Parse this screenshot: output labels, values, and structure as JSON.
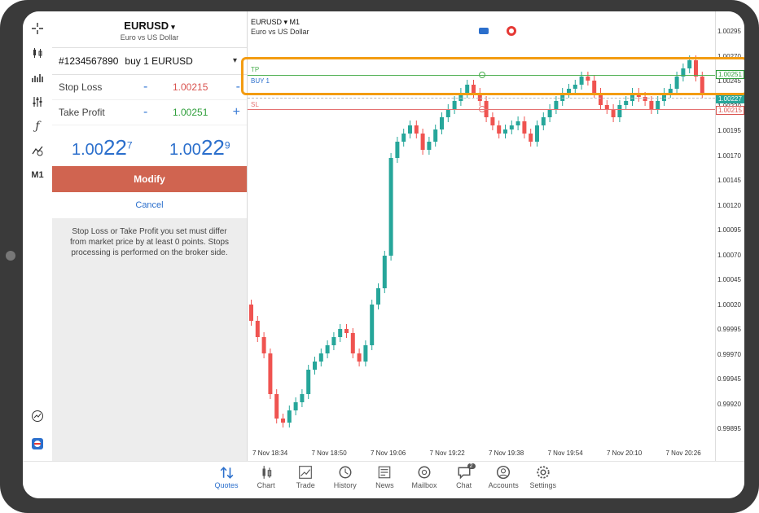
{
  "symbol": {
    "name": "EURUSD",
    "description": "Euro vs US Dollar"
  },
  "ticket": {
    "id": "#1234567890",
    "order": "buy 1 EURUSD"
  },
  "stop_loss": {
    "label": "Stop Loss",
    "value": "1.00215"
  },
  "take_profit": {
    "label": "Take Profit",
    "value": "1.00251"
  },
  "bid": {
    "main": "1.00",
    "big": "22",
    "small": "7"
  },
  "ask": {
    "main": "1.00",
    "big": "22",
    "small": "9"
  },
  "buttons": {
    "modify": "Modify",
    "cancel": "Cancel"
  },
  "note": "Stop Loss or Take Profit you set must differ from market price by at least 0 points. Stops processing is performed on the broker side.",
  "toolbar": {
    "timeframe": "M1"
  },
  "chart": {
    "title": "EURUSD ▾ M1",
    "subtitle": "Euro vs US Dollar",
    "yticks": [
      "1.00295",
      "1.00270",
      "1.00245",
      "1.00220",
      "1.00195",
      "1.00170",
      "1.00145",
      "1.00120",
      "1.00095",
      "1.00070",
      "1.00045",
      "1.00020",
      "0.99995",
      "0.99970",
      "0.99945",
      "0.99920",
      "0.99895"
    ],
    "xticks": [
      "7 Nov 18:34",
      "7 Nov 18:50",
      "7 Nov 19:06",
      "7 Nov 19:22",
      "7 Nov 19:38",
      "7 Nov 19:54",
      "7 Nov 20:10",
      "7 Nov 20:26"
    ],
    "tp_label": "TP",
    "buy_label": "BUY 1",
    "sl_label": "SL",
    "tp_badge": "1.00251",
    "sl_badge": "1.00215",
    "price_badge": "1.00227",
    "colors": {
      "up": "#26a69a",
      "down": "#ef5350",
      "tp": "#4caf50",
      "sl": "#e57373",
      "highlight": "#f39c12"
    }
  },
  "nav": [
    {
      "label": "Quotes",
      "icon": "quotes-icon",
      "active": true
    },
    {
      "label": "Chart",
      "icon": "chart-icon",
      "active": false
    },
    {
      "label": "Trade",
      "icon": "trade-icon",
      "active": false
    },
    {
      "label": "History",
      "icon": "history-icon",
      "active": false
    },
    {
      "label": "News",
      "icon": "news-icon",
      "active": false
    },
    {
      "label": "Mailbox",
      "icon": "mailbox-icon",
      "active": false
    },
    {
      "label": "Chat",
      "icon": "chat-icon",
      "active": false,
      "badge": "2"
    },
    {
      "label": "Accounts",
      "icon": "accounts-icon",
      "active": false
    },
    {
      "label": "Settings",
      "icon": "settings-icon",
      "active": false
    }
  ]
}
